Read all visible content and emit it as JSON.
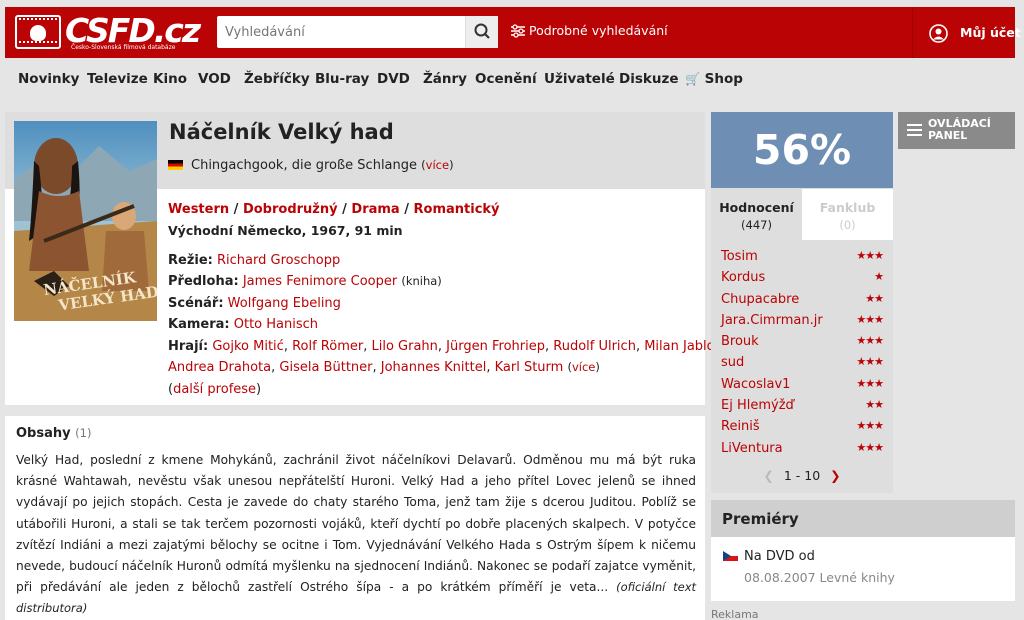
{
  "header": {
    "logo_text": "CSFD.cz",
    "logo_subtitle": "Česko-Slovenská filmová databáze",
    "search_placeholder": "Vyhledávání",
    "advanced_search": "Podrobné vyhledávání",
    "account": "Můj účet",
    "brand_color": "#ba0305"
  },
  "nav": [
    "Novinky",
    "Televize",
    "Kino",
    "VOD",
    "Žebříčky",
    "Blu-ray",
    "DVD",
    "Žánry",
    "Ocenění",
    "Uživatelé",
    "Diskuze",
    "Shop"
  ],
  "film": {
    "title": "Náčelník Velký had",
    "alt_title": "Chingachgook, die große Schlange",
    "more_link": "více",
    "genres": [
      "Western",
      "Dobrodružný",
      "Drama",
      "Romantický"
    ],
    "origin": "Východní Německo, 1967, 91 min",
    "credits": {
      "rezie_label": "Režie:",
      "rezie": "Richard Groschopp",
      "predloha_label": "Předloha:",
      "predloha": "James Fenimore Cooper",
      "predloha_note": "(kniha)",
      "scenar_label": "Scénář:",
      "scenar": "Wolfgang Ebeling",
      "kamera_label": "Kamera:",
      "kamera": "Otto Hanisch",
      "hraji_label": "Hrají:",
      "hraji": [
        "Gojko Mitić",
        "Rolf Römer",
        "Lilo Grahn",
        "Jürgen Frohriep",
        "Rudolf Ulrich",
        "Milan Jablonský",
        "Andrea Drahota",
        "Gisela Büttner",
        "Johannes Knittel",
        "Karl Sturm"
      ],
      "hraji_more": "více",
      "dalsi_profese": "další profese"
    }
  },
  "plot": {
    "heading": "Obsahy",
    "count": "(1)",
    "text": "Velký Had, poslední z kmene Mohykánů, zachránil život náčelníkovi Delavarů. Odměnou mu má být ruka krásné Wahtawah, nevěstu však unesou nepřátelští Huroni. Velký Had a jeho přítel Lovec jelenů se ihned vydávají po jejich stopách. Cesta je zavede do chaty starého Toma, jenž tam žije s dcerou Juditou. Poblíž se utábořili Huroni, a stali se tak terčem pozornosti vojáků, kteří dychtí po dobře placených skalpech. V potyčce zvítězí Indiáni a mezi zajatými bělochy se ocitne i Tom. Vyjednávání Velkého Hada s Ostrým šípem k ničemu nevede, budoucí náčelník Huronů odmítá myšlenku na sjednocení Indiánů. Nakonec se podaří zajatce vyměnit, při předávání ale jeden z bělochů zastřelí Ostrého šípa - a po krátkém příměří je veta...",
    "source": "(oficiální text distributora)"
  },
  "rating": {
    "percent": "56%",
    "box_color": "#6e8eb4",
    "tab_ratings": "Hodnocení",
    "tab_ratings_count": "(447)",
    "tab_fanclub": "Fanklub",
    "tab_fanclub_count": "(0)",
    "users": [
      {
        "name": "Tosim",
        "stars": "★★★"
      },
      {
        "name": "Kordus",
        "stars": "★"
      },
      {
        "name": "Chupacabre",
        "stars": "★★"
      },
      {
        "name": "Jara.Cimrman.jr",
        "stars": "★★★"
      },
      {
        "name": "Brouk",
        "stars": "★★★"
      },
      {
        "name": "sud",
        "stars": "★★★"
      },
      {
        "name": "Wacoslav1",
        "stars": "★★★"
      },
      {
        "name": "Ej Hlemýžď",
        "stars": "★★"
      },
      {
        "name": "Reiniš",
        "stars": "★★★"
      },
      {
        "name": "LiVentura",
        "stars": "★★★"
      }
    ],
    "pager": "1 - 10"
  },
  "control_panel": "OVLÁDACÍ PANEL",
  "premiery": {
    "heading": "Premiéry",
    "line1": "Na DVD od",
    "line2": "08.08.2007 Levné knihy"
  },
  "ad_label": "Reklama"
}
